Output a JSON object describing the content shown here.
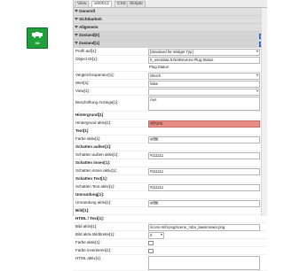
{
  "widget": {
    "label": "ON",
    "color": "#1fa03a"
  },
  "tabs": [
    {
      "label": "View"
    },
    {
      "label": "w00012"
    },
    {
      "label": "CSS"
    },
    {
      "label": "Skripte"
    }
  ],
  "groups": [
    {
      "label": "Generell"
    },
    {
      "label": "Sichtbarkeit"
    },
    {
      "label": "Allgemein"
    },
    {
      "label": "Zustand[0]"
    },
    {
      "label": "Zustand[1]"
    }
  ],
  "fields": {
    "profil": {
      "label": "Profil auf[1]:",
      "value": "[Standard für Widget Typ]"
    },
    "object": {
      "label": "Object ID[1]:",
      "value": "0_userdata.0.NetDevices.Plug.Status"
    },
    "object_sub": {
      "value": "Plug.Status"
    },
    "compare": {
      "label": "Vergleichsoperator[1]:",
      "value": "Gleich"
    },
    "wert": {
      "label": "Wert[1]:",
      "value": "false"
    },
    "view": {
      "label": "View[1]:",
      "value": ""
    },
    "beschriftung": {
      "label": "Beschriftung Anzeige[1]:",
      "value": "Aus"
    },
    "hintergrund": {
      "label": "Hintergrund[1]"
    },
    "hg_aktiv": {
      "label": "Hintergrund aktiv[1]:",
      "value": "#ff7d75"
    },
    "text": {
      "label": "Text[1]"
    },
    "farbe": {
      "label": "Farbe aktiv[1]:",
      "value": "#ffffff"
    },
    "schatten_aussen": {
      "label": "Schatten außen[1]:"
    },
    "sa_aktiv": {
      "label": "Schatten außen aktiv[1]:",
      "value": "#111111"
    },
    "schatten_innen": {
      "label": "Schatten innen[1]:"
    },
    "si_aktiv": {
      "label": "Schatten innen aktiv[1]:",
      "value": "#111111"
    },
    "schatten_text": {
      "label": "Schatten Text[1]:"
    },
    "st_aktiv": {
      "label": "Schatten Text aktiv[1]:",
      "value": "#111111"
    },
    "umrandung": {
      "label": "Umrandung[1]:"
    },
    "um_aktiv": {
      "label": "Umrandung aktiv[1]:",
      "value": "#ffffff"
    },
    "bild": {
      "label": "Bild[1]:"
    },
    "html_text": {
      "label": "HTML / Text[1]:"
    },
    "bild_aktiv": {
      "label": "Bild aktiv[1]:",
      "value": "/icons-mfd-png/scene_robo_lawnmower.png"
    },
    "bildbreite": {
      "label": "Bild aktiv Bildbreite[1]:",
      "value": "0"
    },
    "farbe_aktiv2": {
      "label": "Farbe aktiv[1]:"
    },
    "farbe_invert": {
      "label": "Farbe invertieren[1]:"
    },
    "html_aktiv": {
      "label": "HTML aktiv[1]:"
    }
  }
}
